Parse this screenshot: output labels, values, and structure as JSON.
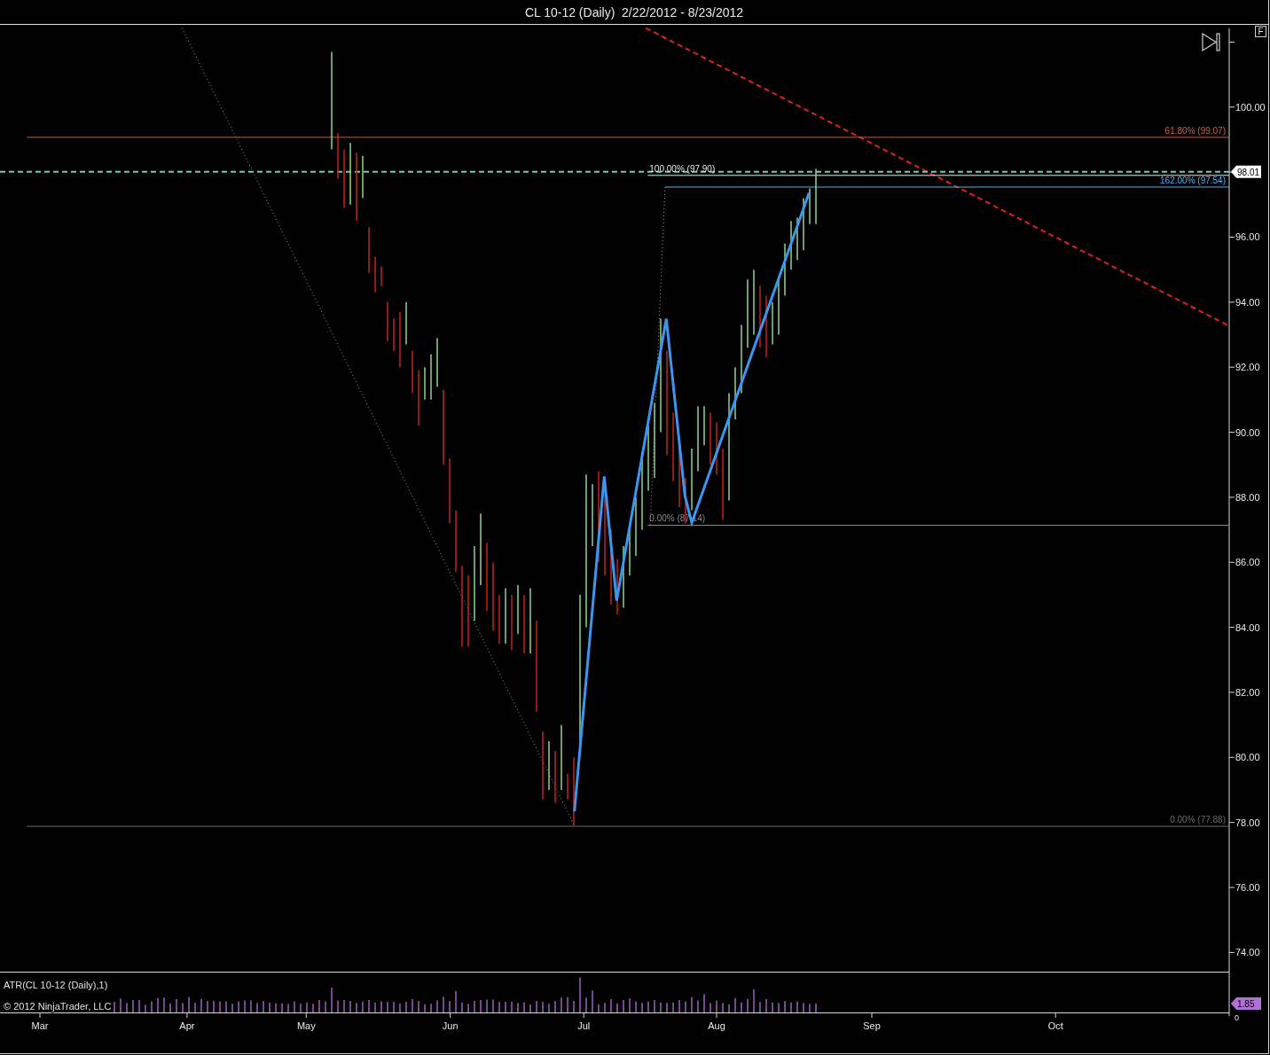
{
  "window": {
    "title": "CL 10-12 (Daily)  2/22/2012 - 8/23/2012"
  },
  "corner_button": {
    "label": "F"
  },
  "price_pane": {
    "axis_labels": [
      "100.00",
      "96.00",
      "94.00",
      "92.00",
      "90.00",
      "88.00",
      "86.00",
      "84.00",
      "82.00",
      "80.00",
      "78.00",
      "76.00",
      "74.00"
    ],
    "fib_labels": [
      "61.80% (99.07)",
      "100.00% (97.90)",
      "162.00% (97.54)",
      "0.00% (87.14)",
      "0.00% (77.88)"
    ],
    "price_tag": "98.01"
  },
  "atr_pane": {
    "title": "ATR(CL 10-12 (Daily),1)",
    "copyright": "© 2012 NinjaTrader, LLC",
    "value_tag": "1.85",
    "axis_label": "0"
  },
  "date_axis": {
    "labels": [
      "Mar",
      "Apr",
      "May",
      "Jun",
      "Jul",
      "Aug",
      "Sep",
      "Oct"
    ]
  }
}
